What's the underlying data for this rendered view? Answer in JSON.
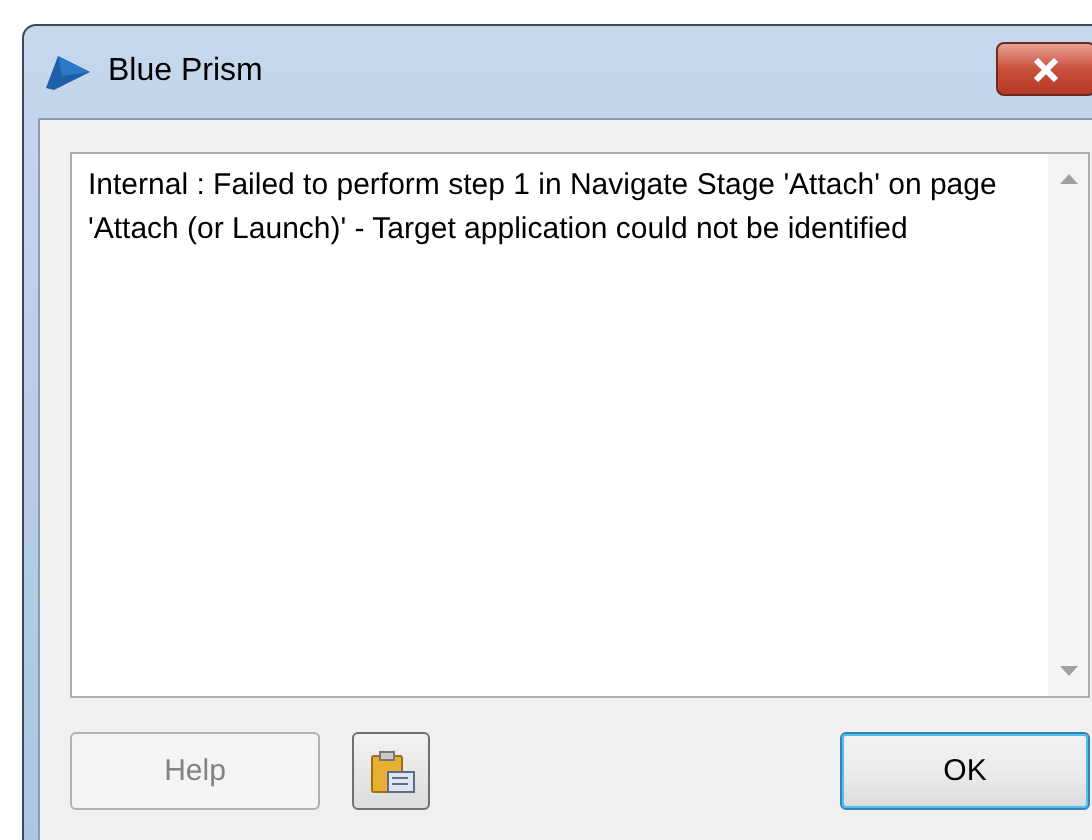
{
  "window": {
    "title": "Blue Prism"
  },
  "message": "Internal : Failed to perform step 1 in Navigate Stage 'Attach' on page 'Attach (or Launch)' - Target application could not be identified",
  "buttons": [
    {
      "kind": "text",
      "label": "Help",
      "disabled": true
    },
    {
      "kind": "clipboard",
      "disabled": false
    },
    {
      "kind": "text",
      "label": "OK",
      "disabled": false
    }
  ]
}
